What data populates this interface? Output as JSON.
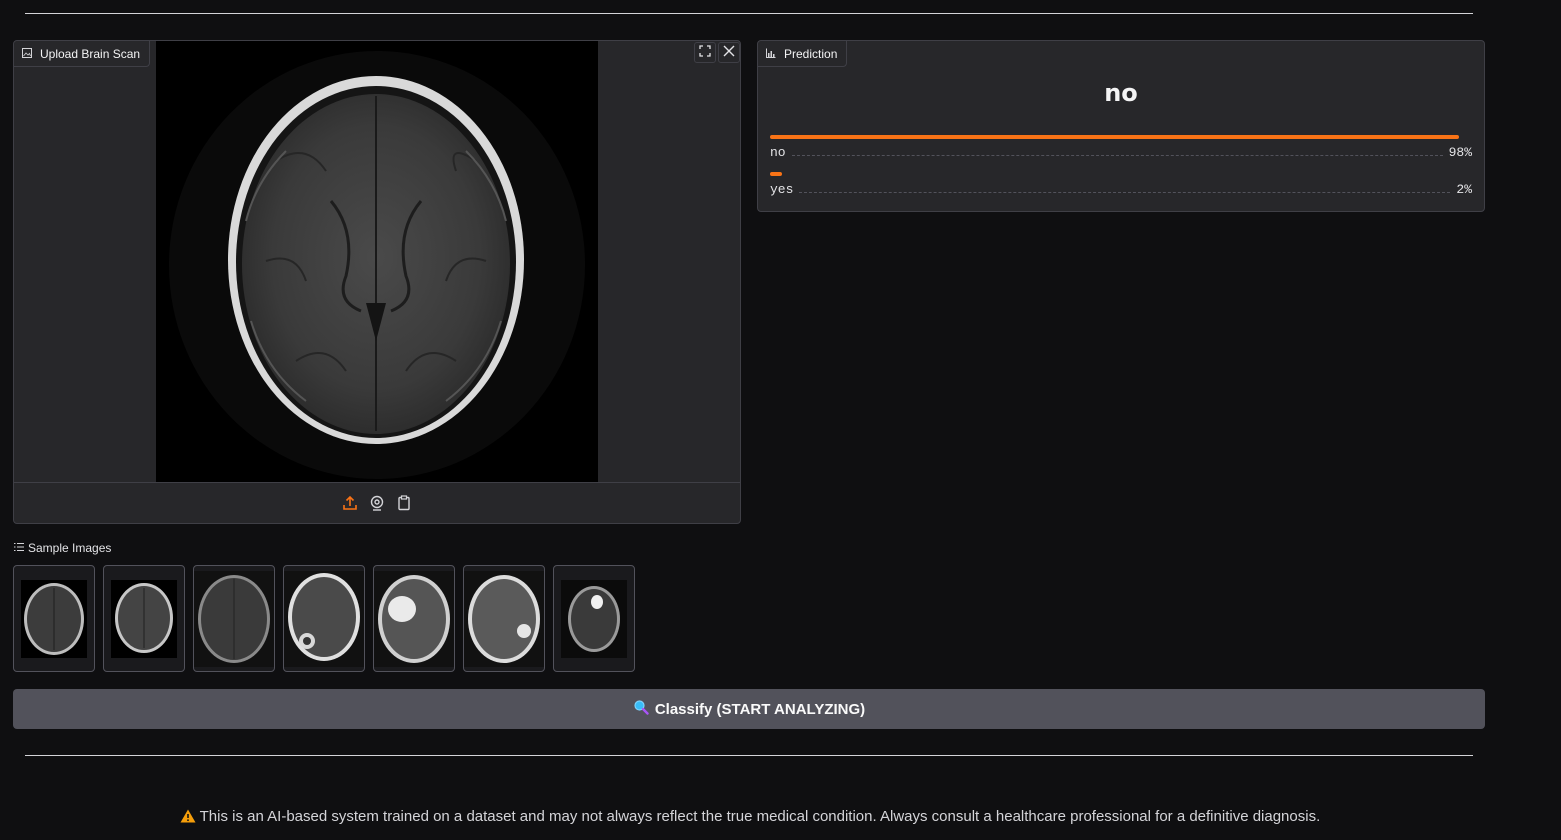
{
  "upload": {
    "label": "Upload Brain Scan",
    "icon": "image-icon",
    "toolbar_icons": [
      "upload-icon",
      "webcam-icon",
      "clipboard-icon"
    ],
    "corner_icons": [
      "fullscreen-icon",
      "close-icon"
    ]
  },
  "prediction": {
    "label": "Prediction",
    "icon": "bar-chart-icon",
    "top_label": "no",
    "confidences": [
      {
        "label": "no",
        "value_text": "98%",
        "value": 0.98
      },
      {
        "label": "yes",
        "value_text": "2%",
        "value": 0.02
      }
    ]
  },
  "samples": {
    "label": "Sample Images",
    "icon": "list-icon",
    "count": 7
  },
  "classify_button": {
    "icon": "magnifier-icon",
    "label": "Classify (START ANALYZING)"
  },
  "disclaimer": {
    "icon": "warning-icon",
    "text": "This is an AI-based system trained on a dataset and may not always reflect the true medical condition. Always consult a healthcare professional for a definitive diagnosis."
  },
  "colors": {
    "accent": "#f97316",
    "background": "#0f0f11",
    "panel": "#27272a",
    "button": "#52525b"
  }
}
